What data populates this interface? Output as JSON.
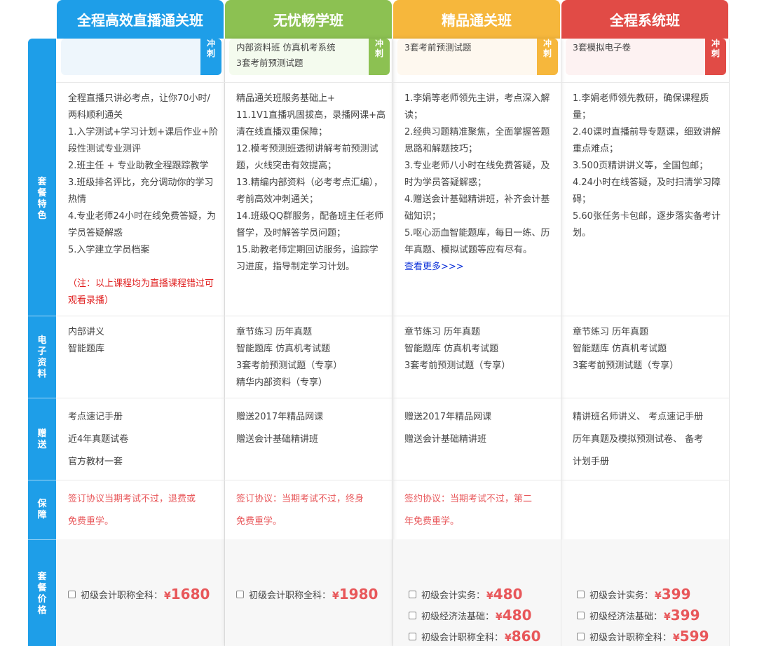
{
  "columns": [
    {
      "title": "全程高效直播通关班",
      "color": "#1e9ee8",
      "promo_bg": "#eef6fc",
      "promo_lines": [],
      "promo_tag": "冲刺",
      "features": [
        "全程直播只讲必考点，让你70小时/两科顺利通关",
        "1.入学测试+学习计划+课后作业+阶段性测试专业测评",
        "2.班主任 + 专业助教全程跟踪教学",
        "3.班级排名评比，充分调动你的学习热情",
        "4.专业老师24小时在线免费答疑，为学员答疑解惑",
        "5.入学建立学员档案"
      ],
      "note": "（注：以上课程均为直播课程错过可观看录播）",
      "materials": [
        "内部讲义",
        "智能题库"
      ],
      "gifts": [
        "考点速记手册",
        "近4年真题试卷",
        "官方教材一套"
      ],
      "guarantee": [
        "签订协议当期考试不过，退费或",
        "免费重学。"
      ],
      "prices": [
        {
          "label": "初级会计职称全科：",
          "yen": "¥",
          "amount": "1680"
        }
      ]
    },
    {
      "title": "无忧畅学班",
      "color": "#8cc152",
      "promo_bg": "#f4fbee",
      "promo_lines": [
        "内部资料班  仿真机考系统",
        "3套考前预测试题"
      ],
      "promo_tag": "冲刺",
      "features": [
        "精品通关班服务基础上+",
        "11.1V1直播巩固拔高，录播网课+高清在线直播双重保障；",
        "12.模考预测班透彻讲解考前预测试题，火线突击有效提高；",
        "13.精编内部资料（必考考点汇编），考前高效冲刺通关；",
        "14.班级QQ群服务，配备班主任老师督学，及时解答学员问题；",
        "15.助教老师定期回访服务，追踪学习进度，指导制定学习计划。"
      ],
      "materials": [
        "章节练习 历年真题",
        "智能题库 仿真机考试题",
        "3套考前预测试题（专享）",
        "精华内部资料（专享）"
      ],
      "gifts": [
        "赠送2017年精品网课",
        "赠送会计基础精讲班"
      ],
      "guarantee": [
        "签订协议：当期考试不过，终身",
        "免费重学。"
      ],
      "prices": [
        {
          "label": "初级会计职称全科：",
          "yen": "¥",
          "amount": "1980"
        }
      ]
    },
    {
      "title": "精品通关班",
      "color": "#f6b73c",
      "promo_bg": "#fef8ef",
      "promo_lines": [
        "3套考前预测试题"
      ],
      "promo_tag": "冲刺",
      "features": [
        "1.李娟等老师领先主讲，考点深入解读；",
        "2.经典习题精准聚焦，全面掌握答题思路和解题技巧；",
        "3.专业老师八小时在线免费答疑，及时为学员答疑解惑；",
        "4.赠送会计基础精讲班，补齐会计基础知识；",
        "5.呕心沥血智能题库，每日一练、历年真题、模拟试题等应有尽有。"
      ],
      "more_link": "查看更多>>>",
      "materials": [
        "章节练习 历年真题",
        "智能题库 仿真机考试题",
        "3套考前预测试题（专享）"
      ],
      "gifts": [
        "赠送2017年精品网课",
        "赠送会计基础精讲班"
      ],
      "guarantee": [
        "签约协议：当期考试不过，第二",
        "年免费重学。"
      ],
      "prices": [
        {
          "label": "初级会计实务：",
          "yen": "¥",
          "amount": "480"
        },
        {
          "label": "初级经济法基础：",
          "yen": "¥",
          "amount": "480"
        },
        {
          "label": "初级会计职称全科：",
          "yen": "¥",
          "amount": "860"
        }
      ]
    },
    {
      "title": "全程系统班",
      "color": "#e14b46",
      "promo_bg": "#fdf2f2",
      "promo_lines": [
        "3套模拟电子卷"
      ],
      "promo_tag": "冲刺",
      "features": [
        "1.李娟老师领先教研，确保课程质量；",
        "2.40课时直播前导专题课，细致讲解重点难点；",
        "3.500页精讲讲义等，全国包邮；",
        "4.24小时在线答疑，及时扫清学习障碍；",
        "5.60张任务卡包邮，逐步落实备考计划。"
      ],
      "materials": [
        "章节练习 历年真题",
        "智能题库 仿真机考试题",
        "3套考前预测试题（专享）"
      ],
      "gifts": [
        "精讲班名师讲义、 考点速记手册",
        "历年真题及模拟预测试卷、 备考",
        "计划手册"
      ],
      "guarantee": [],
      "prices": [
        {
          "label": "初级会计实务：",
          "yen": "¥",
          "amount": "399"
        },
        {
          "label": "初级经济法基础：",
          "yen": "¥",
          "amount": "399"
        },
        {
          "label": "初级会计职称全科：",
          "yen": "¥",
          "amount": "599"
        }
      ]
    }
  ],
  "sidebar": {
    "rows": [
      "套餐特色",
      "电子资料",
      "赠送",
      "保障",
      "套餐价格"
    ]
  }
}
